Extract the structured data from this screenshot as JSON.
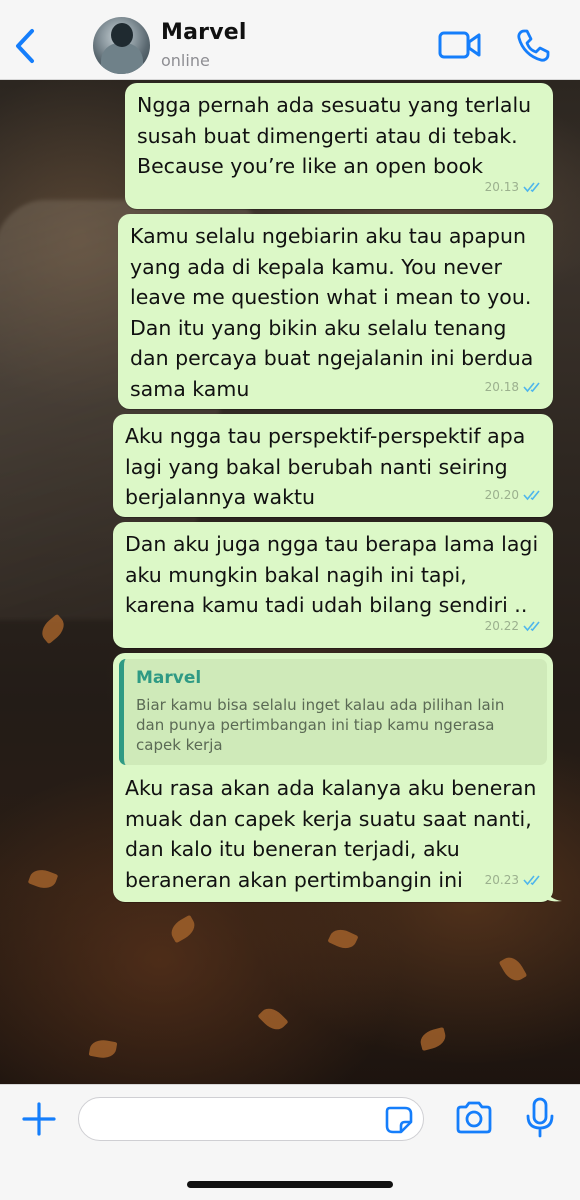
{
  "header": {
    "contact_name": "Marvel",
    "contact_status": "online",
    "icons": {
      "back": "chevron-left-icon",
      "video": "video-camera-icon",
      "call": "phone-icon"
    }
  },
  "messages": [
    {
      "text": "Ngga pernah ada sesuatu yang terlalu\nsusah buat dimengerti atau di tebak.\nBecause you’re like an open book",
      "time": "20.13",
      "status": "read"
    },
    {
      "text": "Kamu selalu ngebiarin aku tau apapun\nyang ada di kepala kamu. You never\nleave me question what i mean to you.\nDan itu yang bikin aku selalu tenang\ndan percaya buat ngejalanin ini berdua\nsama kamu",
      "time": "20.18",
      "status": "read"
    },
    {
      "text": "Aku ngga tau perspektif-perspektif apa\nlagi yang bakal berubah nanti seiring\nberjalannya waktu",
      "time": "20.20",
      "status": "read"
    },
    {
      "text": "Dan aku juga ngga tau berapa lama lagi\naku mungkin bakal nagih ini tapi,\nkarena kamu tadi udah bilang sendiri ..",
      "time": "20.22",
      "status": "read"
    },
    {
      "quote": {
        "author": "Marvel",
        "text": "Biar kamu bisa selalu inget kalau ada pilihan lain\ndan punya pertimbangan ini tiap kamu ngerasa\ncapek kerja"
      },
      "text": "Aku rasa akan ada kalanya aku beneran\nmuak dan capek kerja suatu saat nanti,\ndan kalo itu beneran terjadi, aku\nberaneran akan pertimbangin ini",
      "time": "20.23",
      "status": "read"
    }
  ],
  "input_bar": {
    "placeholder": "",
    "value": "",
    "icons": {
      "plus": "plus-icon",
      "sticker": "sticker-icon",
      "camera": "camera-icon",
      "mic": "microphone-icon"
    }
  },
  "colors": {
    "accent": "#157efb",
    "outgoing_bubble": "#dcf8c7",
    "quote_bar": "#2f9a84",
    "read_ticks": "#4fb6ec"
  }
}
